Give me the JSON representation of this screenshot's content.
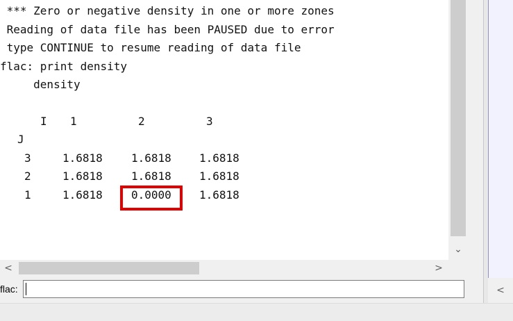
{
  "console": {
    "lines": [
      " *** Zero or negative density in one or more zones",
      " Reading of data file has been PAUSED due to error",
      " type CONTINUE to resume reading of data file",
      "flac: print density",
      "     density"
    ],
    "table": {
      "i_label": "I",
      "j_label": "J",
      "col_headers": [
        "1",
        "2",
        "3"
      ],
      "rows": [
        {
          "j": "3",
          "values": [
            "1.6818",
            "1.6818",
            "1.6818"
          ]
        },
        {
          "j": "2",
          "values": [
            "1.6818",
            "1.6818",
            "1.6818"
          ]
        },
        {
          "j": "1",
          "values": [
            "1.6818",
            "0.0000",
            "1.6818"
          ]
        }
      ],
      "highlighted_value": "0.0000"
    }
  },
  "command": {
    "prompt_label": "flac:",
    "value": ""
  },
  "icons": {
    "scroll_down": "chevron-down-icon",
    "scroll_left": "chevron-left-icon",
    "scroll_right": "chevron-right-icon"
  },
  "colors": {
    "highlight_border": "#e30000",
    "console_background": "#ffffff",
    "right_pane_background": "#f2f2ff"
  }
}
